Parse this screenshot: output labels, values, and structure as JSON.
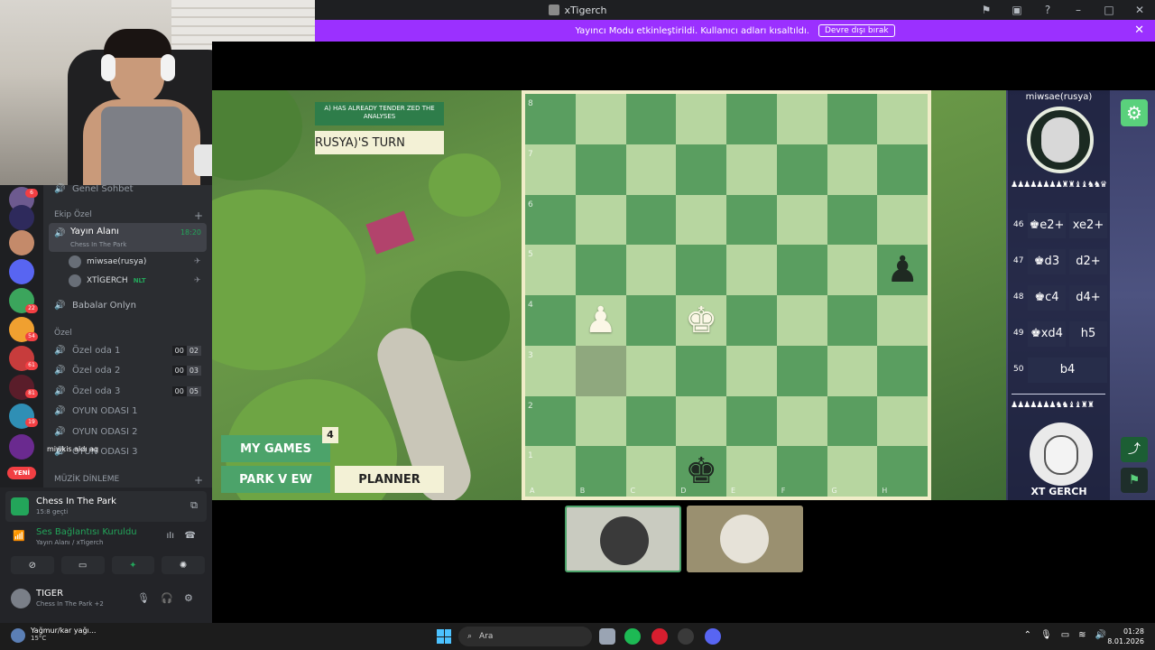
{
  "titlebar": {
    "title": "xTigerch"
  },
  "streamer_banner": {
    "text": "Yayıncı Modu etkinleştirildi. Kullanıcı adları kısaltıldı.",
    "button": "Devre dışı bırak",
    "close": "✕"
  },
  "rail": {
    "badges": [
      "6",
      "22",
      "54",
      "61",
      "81",
      "19"
    ],
    "new_label": "YENİ"
  },
  "channels": {
    "top_item": "Genel Sohbet",
    "category_team": "Ekip Özel",
    "active": {
      "name": "Yayın Alanı",
      "activity": "Chess In The Park",
      "time": "18:20"
    },
    "voice_users": [
      {
        "name": "miwsae(rusya)"
      },
      {
        "name": "XTİGERCH",
        "tag": "NLT"
      }
    ],
    "babalar": "Babalar Onlyn",
    "category_private": "Özel",
    "private_rooms": [
      {
        "name": "Özel oda 1",
        "a": "00",
        "b": "02"
      },
      {
        "name": "Özel oda 2",
        "a": "00",
        "b": "03"
      },
      {
        "name": "Özel oda 3",
        "a": "00",
        "b": "05"
      }
    ],
    "game_rooms": [
      "OYUN ODASI 1",
      "OYUN ODASI 2",
      "OYUN ODASI 3"
    ],
    "category_music": "MÜZİK DİNLEME",
    "overlay_message": "miwkis aldı aq"
  },
  "voice_panel": {
    "activity_title": "Chess In The Park",
    "activity_sub": "15:8 geçti",
    "connection_title": "Ses Bağlantısı Kuruldu",
    "connection_sub": "Yayın Alanı / xTigerch",
    "user_name": "TIGER",
    "user_status": "Chess In The Park +2"
  },
  "game": {
    "banner_line1": "A) HAS ALREADY TENDER ZED THE ANALYSES",
    "turn_label": "RUSYA)'S TURN",
    "my_games": "MY GAMES",
    "my_games_count": "4",
    "park_view": "PARK V EW",
    "planner": "PLANNER"
  },
  "board": {
    "ranks": [
      "8",
      "7",
      "6",
      "5",
      "4",
      "3",
      "2",
      "1"
    ],
    "files": [
      "A",
      "B",
      "C",
      "D",
      "E",
      "F",
      "G",
      "H"
    ],
    "pieces": [
      {
        "square": "h5",
        "glyph": "♟",
        "color": "b"
      },
      {
        "square": "b4",
        "glyph": "♟",
        "color": "w"
      },
      {
        "square": "d4",
        "glyph": "♚",
        "color": "w"
      },
      {
        "square": "d1",
        "glyph": "♚",
        "color": "b"
      }
    ],
    "highlight": "b3"
  },
  "right_panel": {
    "opponent_name": "miwsae(rusya)",
    "opponent_captured": "♟♟♟♟♟♟♟♟♜♜♝♝♞♞♛",
    "moves": [
      {
        "num": "46",
        "white": "♚e2+",
        "black": "xe2+"
      },
      {
        "num": "47",
        "white": "♚d3",
        "black": "d2+"
      },
      {
        "num": "48",
        "white": "♚c4",
        "black": "d4+"
      },
      {
        "num": "49",
        "white": "♚xd4",
        "black": "h5"
      },
      {
        "num": "50",
        "white": "b4",
        "black": ""
      }
    ],
    "my_captured": "♟♟♟♟♟♟♟♞♞♝♝♜♜",
    "my_name": "XT GERCH",
    "gear": "⚙",
    "share": "⤴",
    "flag": "⚑"
  },
  "taskbar": {
    "weather_title": "Yağmur/kar yağı...",
    "weather_temp": "15°C",
    "search": "Ara",
    "time": "01:28",
    "date": "8.01.2026"
  }
}
